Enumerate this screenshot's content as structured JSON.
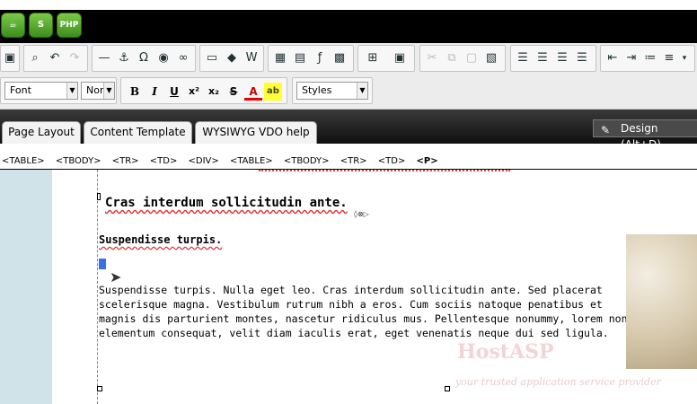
{
  "header": {
    "apps": [
      {
        "name": "coffee-app",
        "glyph": "☕"
      },
      {
        "name": "s-app",
        "glyph": "S"
      },
      {
        "name": "php-app",
        "glyph": "PHP"
      }
    ]
  },
  "toolbar": {
    "font_select": "Font",
    "size_select": "Norm",
    "styles_select": "Styles",
    "bold": "B",
    "italic": "I",
    "underline": "U",
    "superscript": "x²",
    "subscript": "x₂",
    "strike": "S",
    "forecolor": "A",
    "highlight": "ab"
  },
  "tabs": [
    {
      "label": "Page Layout"
    },
    {
      "label": "Content Template"
    },
    {
      "label": "WYSIWYG VDO help"
    }
  ],
  "design_tab": "Design (Alt+D)",
  "tag_path": [
    "<TABLE>",
    "<TBODY>",
    "<TR>",
    "<TD>",
    "<DIV>",
    "<TABLE>",
    "<TBODY>",
    "<TR>",
    "<TD>",
    "<P>"
  ],
  "editor": {
    "heading": "Cras interdum sollicitudin ante.",
    "subheading": "Suspendisse turpis.",
    "body": "Suspendisse turpis. Nulla eget leo. Cras interdum sollicitudin ante. Sed placerat scelerisque magna. Vestibulum rutrum nibh a eros. Cum sociis natoque penatibus et magnis dis parturient montes, nascetur ridiculus mus. Pellentesque nonummy, lorem non elementum consequat, velit diam iaculis erat, eget venenatis neque dui sed ligula.",
    "watermark_brand": "HostASP",
    "watermark_tagline": "your trusted application service provider"
  }
}
